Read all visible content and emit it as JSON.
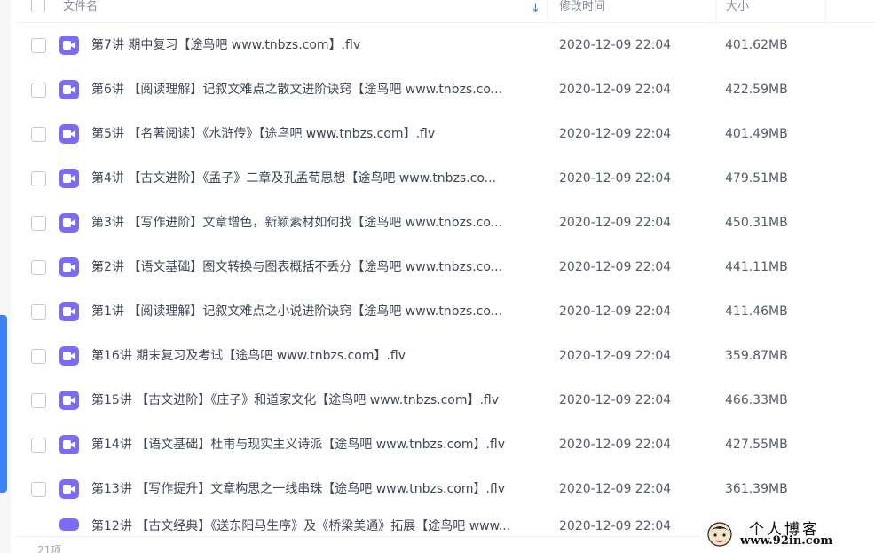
{
  "header": {
    "name_label": "文件名",
    "time_label": "修改时间",
    "size_label": "大小"
  },
  "files": [
    {
      "name": "第7讲 期中复习【途鸟吧 www.tnbzs.com】.flv",
      "modified": "2020-12-09 22:04",
      "size": "401.62MB"
    },
    {
      "name": "第6讲 【阅读理解】记叙文难点之散文进阶诀窍【途鸟吧 www.tnbzs.co...",
      "modified": "2020-12-09 22:04",
      "size": "422.59MB"
    },
    {
      "name": "第5讲 【名著阅读】《水浒传》【途鸟吧 www.tnbzs.com】.flv",
      "modified": "2020-12-09 22:04",
      "size": "401.49MB"
    },
    {
      "name": "第4讲 【古文进阶】《孟子》二章及孔孟荀思想【途鸟吧 www.tnbzs.co...",
      "modified": "2020-12-09 22:04",
      "size": "479.51MB"
    },
    {
      "name": "第3讲 【写作进阶】文章增色，新颖素材如何找【途鸟吧 www.tnbzs.co...",
      "modified": "2020-12-09 22:04",
      "size": "450.31MB"
    },
    {
      "name": "第2讲 【语文基础】图文转换与图表概括不丢分【途鸟吧 www.tnbzs.co...",
      "modified": "2020-12-09 22:04",
      "size": "441.11MB"
    },
    {
      "name": "第1讲 【阅读理解】记叙文难点之小说进阶诀窍【途鸟吧 www.tnbzs.co...",
      "modified": "2020-12-09 22:04",
      "size": "411.46MB"
    },
    {
      "name": "第16讲 期末复习及考试【途鸟吧 www.tnbzs.com】.flv",
      "modified": "2020-12-09 22:04",
      "size": "359.87MB"
    },
    {
      "name": "第15讲 【古文进阶】《庄子》和道家文化【途鸟吧 www.tnbzs.com】.flv",
      "modified": "2020-12-09 22:04",
      "size": "466.33MB"
    },
    {
      "name": "第14讲 【语文基础】杜甫与现实主义诗派【途鸟吧 www.tnbzs.com】.flv",
      "modified": "2020-12-09 22:04",
      "size": "427.55MB"
    },
    {
      "name": "第13讲 【写作提升】文章构思之一线串珠【途鸟吧 www.tnbzs.com】.flv",
      "modified": "2020-12-09 22:04",
      "size": "361.39MB"
    },
    {
      "name": "第12讲 【古文经典】《送东阳马生序》及《桥梁美通》拓展【途鸟吧 www...",
      "modified": "2020-12-09 22:04",
      "size": ""
    }
  ],
  "footer": {
    "count": "21项"
  },
  "watermark": {
    "title": "个人博客",
    "url": "www.92in.com"
  },
  "colors": {
    "accent": "#3b82f6",
    "video_icon": "#7b6cf6"
  },
  "icons": {
    "sort": "arrow-down-icon",
    "file": "video-file-icon"
  }
}
